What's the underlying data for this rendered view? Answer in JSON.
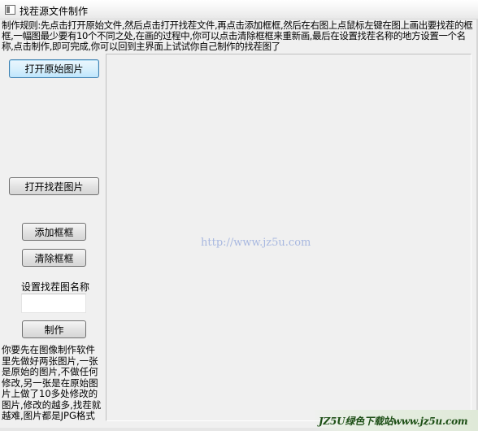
{
  "window": {
    "title": "找茬源文件制作"
  },
  "rules_text": "制作规则:先点击打开原始文件,然后点击打开找茬文件,再点击添加框框,然后在右图上点鼠标左键在图上画出要找茬的框框,一幅图最少要有10个不同之处,在画的过程中,你可以点击清除框框来重新画,最后在设置找茬名称的地方设置一个名称,点击制作,即可完成,你可以回到主界面上试试你自己制作的找茬图了",
  "buttons": {
    "open_original": "打开原始图片",
    "open_spot": "打开找茬图片",
    "add_box": "添加框框",
    "clear_box": "清除框框",
    "make": "制作"
  },
  "name_label": "设置找茬图名称",
  "name_input_value": "",
  "note_text": "你要先在图像制作软件里先做好两张图片,一张是原始的图片,不做任何修改,另一张是在原始图片上做了10多处修改的图片,修改的越多,找茬就越难,图片都是JPG格式的",
  "watermark_url": "http://www.jz5u.com",
  "brand_watermark": "JZ5U绿色下载站www.jz5u.com"
}
